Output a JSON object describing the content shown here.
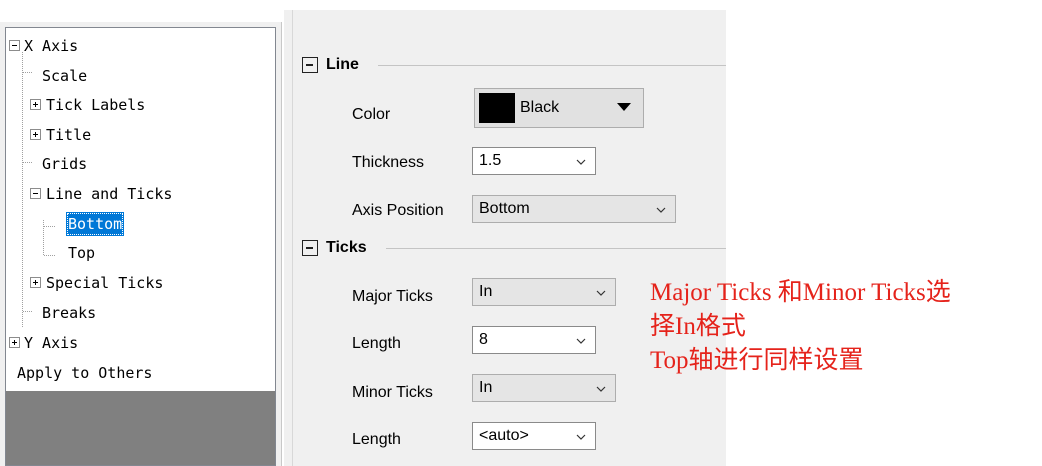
{
  "tree": {
    "x_axis": "X Axis",
    "scale": "Scale",
    "tick_labels": "Tick Labels",
    "title": "Title",
    "grids": "Grids",
    "line_and_ticks": "Line and Ticks",
    "bottom": "Bottom",
    "top": "Top",
    "special_ticks": "Special Ticks",
    "breaks": "Breaks",
    "y_axis": "Y Axis",
    "apply_to_others": "Apply to Others"
  },
  "line_section": {
    "header": "Line",
    "color_label": "Color",
    "color_value": "Black",
    "color_hex": "#000000",
    "thickness_label": "Thickness",
    "thickness_value": "1.5",
    "axis_position_label": "Axis Position",
    "axis_position_value": "Bottom"
  },
  "ticks_section": {
    "header": "Ticks",
    "major_ticks_label": "Major Ticks",
    "major_ticks_value": "In",
    "major_length_label": "Length",
    "major_length_value": "8",
    "minor_ticks_label": "Minor Ticks",
    "minor_ticks_value": "In",
    "minor_length_label": "Length",
    "minor_length_value": "<auto>"
  },
  "annotation": {
    "line1": "Major Ticks 和Minor Ticks选",
    "line2": "择In格式",
    "line3": "Top轴进行同样设置",
    "color": "#e5231b"
  },
  "colors": {
    "selection": "#0078d7",
    "panel_bg": "#f0f0f0"
  }
}
